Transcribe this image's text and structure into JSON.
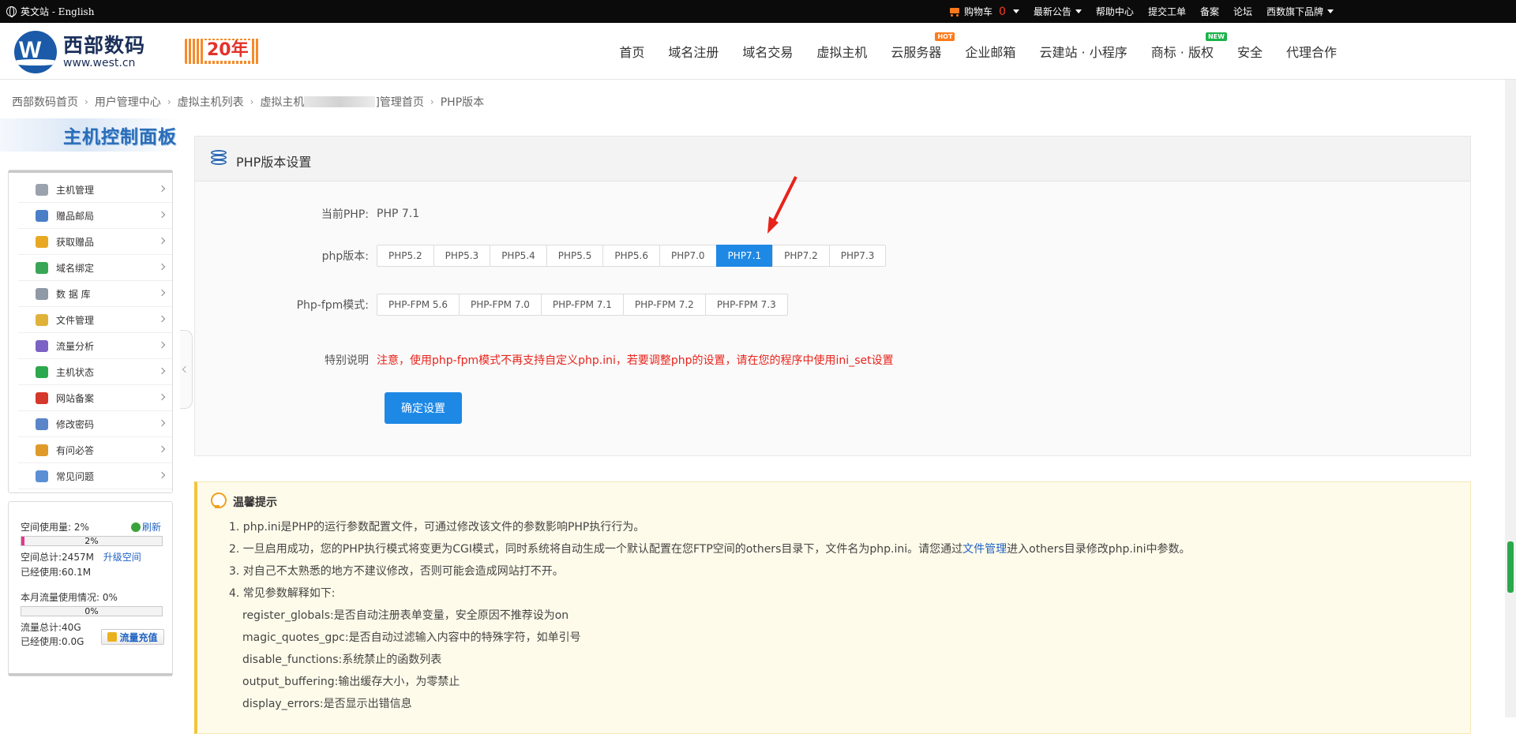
{
  "topbar": {
    "lang_label": "英文站 - English",
    "cart_label": "购物车",
    "cart_count": "0",
    "links": [
      "最新公告",
      "帮助中心",
      "提交工单",
      "备案",
      "论坛",
      "西数旗下品牌"
    ]
  },
  "header": {
    "logo_cn": "西部数码",
    "logo_url": "www.west.cn",
    "anniversary": "20年",
    "nav": [
      {
        "label": "首页"
      },
      {
        "label": "域名注册"
      },
      {
        "label": "域名交易"
      },
      {
        "label": "虚拟主机"
      },
      {
        "label": "云服务器",
        "badge": "HOT"
      },
      {
        "label": "企业邮箱"
      },
      {
        "label": "云建站 · 小程序"
      },
      {
        "label": "商标 · 版权",
        "badge": "NEW"
      },
      {
        "label": "安全"
      },
      {
        "label": "代理合作"
      }
    ]
  },
  "breadcrumb": [
    "西部数码首页",
    "用户管理中心",
    "虚拟主机列表",
    "虚拟主机",
    "]管理首页",
    "PHP版本"
  ],
  "sidebar": {
    "banner": "主机控制面板",
    "items": [
      {
        "label": "主机管理",
        "icon": "server-icon",
        "color": "#9aa3ad"
      },
      {
        "label": "赠品邮局",
        "icon": "mail-icon",
        "color": "#4a7fc8"
      },
      {
        "label": "获取赠品",
        "icon": "gift-icon",
        "color": "#e8a823"
      },
      {
        "label": "域名绑定",
        "icon": "globe-icon",
        "color": "#3aa655"
      },
      {
        "label": "数 据 库",
        "icon": "database-icon",
        "color": "#8f9aa6"
      },
      {
        "label": "文件管理",
        "icon": "folder-icon",
        "color": "#e0b23a"
      },
      {
        "label": "流量分析",
        "icon": "chart-icon",
        "color": "#7b62c4"
      },
      {
        "label": "主机状态",
        "icon": "status-icon",
        "color": "#2ea84c"
      },
      {
        "label": "网站备案",
        "icon": "record-icon",
        "color": "#d6372b"
      },
      {
        "label": "修改密码",
        "icon": "key-icon",
        "color": "#5a86c9"
      },
      {
        "label": "有问必答",
        "icon": "user-help-icon",
        "color": "#e09a2a"
      },
      {
        "label": "常见问题",
        "icon": "faq-icon",
        "color": "#5b8fd4"
      }
    ],
    "usage": {
      "space_label": "空间使用量: 2%",
      "refresh": "刷新",
      "space_percent": 2,
      "space_bar_text": "2%",
      "space_total": "空间总计:2457M",
      "upgrade": "升级空间",
      "space_used": "已经使用:60.1M",
      "traffic_label": "本月流量使用情况: 0%",
      "traffic_percent": 0,
      "traffic_bar_text": "0%",
      "traffic_total": "流量总计:40G",
      "traffic_used": "已经使用:0.0G",
      "charge": "流量充值"
    }
  },
  "main": {
    "title": "PHP版本设置",
    "current_label": "当前PHP:",
    "current_value": "PHP 7.1",
    "version_label": "php版本:",
    "versions": [
      "PHP5.2",
      "PHP5.3",
      "PHP5.4",
      "PHP5.5",
      "PHP5.6",
      "PHP7.0",
      "PHP7.1",
      "PHP7.2",
      "PHP7.3"
    ],
    "active_version": "PHP7.1",
    "fpm_label": "Php-fpm模式:",
    "fpm_modes": [
      "PHP-FPM 5.6",
      "PHP-FPM 7.0",
      "PHP-FPM 7.1",
      "PHP-FPM 7.2",
      "PHP-FPM 7.3"
    ],
    "note_label": "特别说明",
    "note_text": "注意，使用php-fpm模式不再支持自定义php.ini，若要调整php的设置，请在您的程序中使用ini_set设置",
    "confirm": "确定设置",
    "accent": "#1e88e5",
    "note_color": "#e8231b"
  },
  "tips": {
    "title": "温馨提示",
    "line1": "1. php.ini是PHP的运行参数配置文件，可通过修改该文件的参数影响PHP执行行为。",
    "line2_a": "2. 一旦启用成功，您的PHP执行模式将变更为CGI模式，同时系统将自动生成一个默认配置在您FTP空间的others目录下，文件名为php.ini。请您通过",
    "line2_link": "文件管理",
    "line2_b": "进入others目录修改php.ini中参数。",
    "line3": "3. 对自己不太熟悉的地方不建议修改，否则可能会造成网站打不开。",
    "line4": "4. 常见参数解释如下:",
    "params": [
      "register_globals:是否自动注册表单变量，安全原因不推荐设为on",
      "magic_quotes_gpc:是否自动过滤输入内容中的特殊字符，如单引号",
      "disable_functions:系统禁止的函数列表",
      "output_buffering:输出缓存大小，为零禁止",
      "display_errors:是否显示出错信息"
    ]
  }
}
